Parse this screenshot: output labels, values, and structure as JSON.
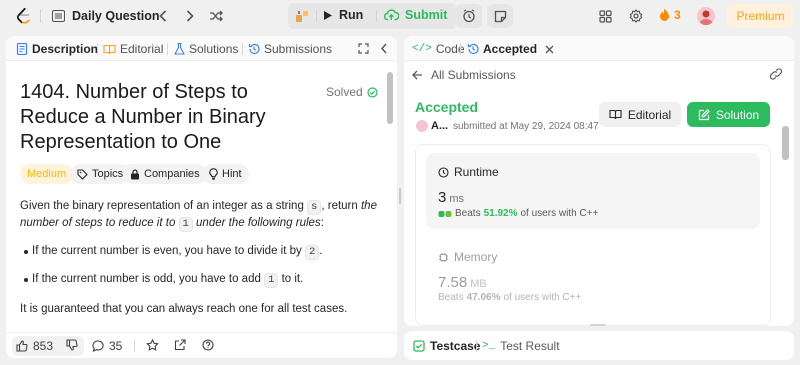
{
  "header": {
    "title": "Daily Question",
    "run_label": "Run",
    "submit_label": "Submit",
    "streak_count": "3",
    "premium_label": "Premium"
  },
  "left_panel": {
    "tabs": [
      {
        "label": "Description",
        "active": true
      },
      {
        "label": "Editorial",
        "active": false
      },
      {
        "label": "Solutions",
        "active": false
      },
      {
        "label": "Submissions",
        "active": false
      }
    ],
    "problem": {
      "title": "1404. Number of Steps to Reduce a Number in Binary Representation to One",
      "status": "Solved",
      "difficulty": "Medium",
      "chips": [
        "Topics",
        "Companies",
        "Hint"
      ],
      "desc_line1_a": "Given the binary representation of an integer as a string ",
      "desc_code_s": "s",
      "desc_line1_b": ", return ",
      "desc_line1_c": "the",
      "desc_line2_a": "number of steps to reduce it to ",
      "desc_code_1": "1",
      "desc_line2_b": " under the following rules",
      "desc_line2_c": ":",
      "rule1_text": "If the current number is even, you have to divide it by ",
      "rule1_code": "2",
      "rule1_end": ".",
      "rule2_text": "If the current number is odd, you have to add ",
      "rule2_code": "1",
      "rule2_end": " to it.",
      "guarantee": "It is guaranteed that you can always reach one for all test cases."
    },
    "footer": {
      "likes": "853",
      "comments": "35"
    }
  },
  "right_panel": {
    "tabs": [
      {
        "label": "Code",
        "active": false
      },
      {
        "label": "Accepted",
        "active": true
      }
    ],
    "back_label": "All Submissions",
    "result": "Accepted",
    "user": "A...",
    "submitted_at": "submitted at May 29, 2024 08:47",
    "editorial_btn": "Editorial",
    "solution_btn": "Solution",
    "runtime": {
      "label": "Runtime",
      "value": "3",
      "unit": "ms",
      "beats_prefix": "Beats",
      "beats_pct": "51.92%",
      "beats_suffix": "of users with C++"
    },
    "memory": {
      "label": "Memory",
      "value": "7.58",
      "unit": "MB",
      "beats_prefix": "Beats",
      "beats_pct": "47.06%",
      "beats_suffix": "of users with C++"
    }
  },
  "bottom_panel": {
    "testcase_label": "Testcase",
    "testresult_label": "Test Result"
  },
  "colors": {
    "accent_green": "#2cbb5d",
    "medium_yellow": "#ffb800",
    "premium_orange": "#ffa116",
    "streak_orange": "#ff8a00"
  }
}
